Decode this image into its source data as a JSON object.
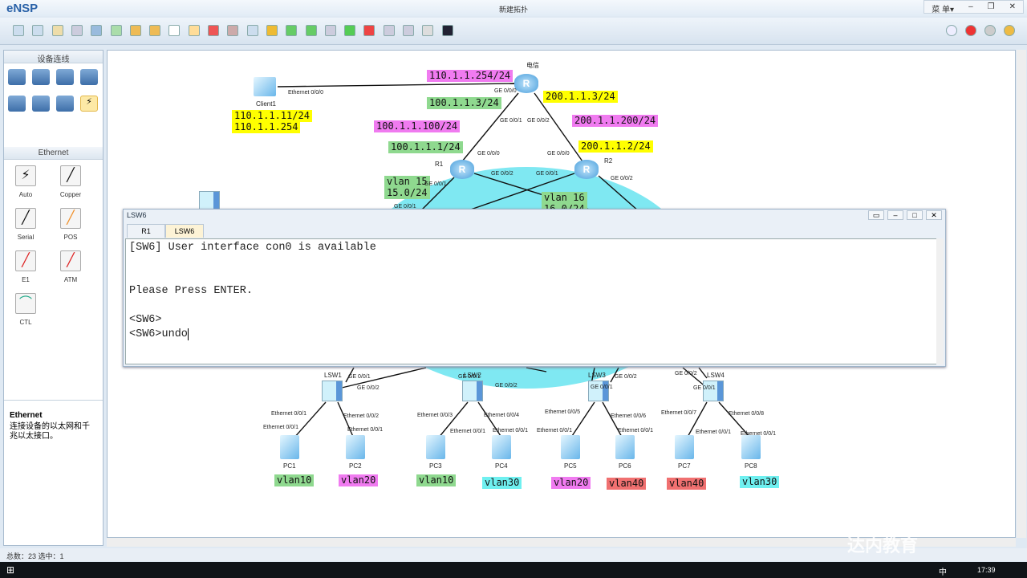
{
  "app": {
    "name": "eNSP",
    "title": "新建拓扑",
    "menu": "菜 单▾",
    "minimize": "–",
    "restore": "❐",
    "close": "✕"
  },
  "toolbar": {
    "icons": [
      "new-topo",
      "new-example",
      "open",
      "save",
      "save-as",
      "print",
      "undo",
      "redo",
      "select",
      "pan",
      "delete",
      "delete-link",
      "text",
      "palette",
      "zoom-in",
      "zoom-out",
      "fit",
      "start",
      "stop",
      "collect",
      "topology",
      "grid",
      "cli"
    ],
    "right_icons": [
      "feedback",
      "huawei",
      "settings",
      "help"
    ]
  },
  "left_panel": {
    "devices_header": "设备连线",
    "devices": [
      "router",
      "switch",
      "wlan",
      "firewall",
      "pc",
      "cloud",
      "other",
      "connection"
    ],
    "cables_header": "Ethernet",
    "cables": [
      {
        "label": "Auto",
        "glyph": "⚡"
      },
      {
        "label": "Copper",
        "glyph": "╱"
      },
      {
        "label": "Serial",
        "glyph": "╱"
      },
      {
        "label": "POS",
        "glyph": "╱"
      },
      {
        "label": "E1",
        "glyph": "╱"
      },
      {
        "label": "ATM",
        "glyph": "╱"
      },
      {
        "label": "CTL",
        "glyph": "⌒"
      }
    ],
    "desc_title": "Ethernet",
    "desc_text": "连接设备的以太网和千兆以太接口。"
  },
  "topology": {
    "nodes": [
      "电信",
      "R1",
      "R2",
      "Client1",
      "LSW1",
      "LSW2",
      "LSW3",
      "LSW4",
      "PC1",
      "PC2",
      "PC3",
      "PC4",
      "PC5",
      "PC6",
      "PC7",
      "PC8"
    ],
    "ip_labels": [
      "110.1.1.254/24",
      "100.1.1.3/24",
      "200.1.1.3/24",
      "200.1.1.200/24",
      "100.1.1.100/24",
      "100.1.1.1/24",
      "200.1.1.2/24",
      "vlan 15",
      "15.0/24",
      "vlan 16",
      "16.0/24",
      "110.1.1.11/24",
      "110.1.1.254"
    ],
    "vlan_labels": [
      "vlan10",
      "vlan20",
      "vlan10",
      "vlan30",
      "vlan20",
      "vlan40",
      "vlan40",
      "vlan30"
    ],
    "ports": [
      "Ethernet 0/0/0",
      "GE 0/0/0",
      "GE 0/0/1",
      "GE 0/0/2",
      "GE 0/0/0",
      "GE 0/0/0",
      "GE 0/0/2",
      "GE 0/0/1",
      "GE 0/0/2",
      "GE 0/0/1",
      "GE 0/0/1",
      "GE 0/0/1",
      "GE 0/0/2",
      "GE 0/0/1",
      "GE 0/0/2",
      "GE 0/0/1",
      "GE 0/0/2",
      "GE 0/0/2",
      "GE 0/0/1",
      "Ethernet 0/0/1",
      "Ethernet 0/0/1",
      "Ethernet 0/0/2",
      "Ethernet 0/0/1",
      "Ethernet 0/0/3",
      "Ethernet 0/0/1",
      "Ethernet 0/0/4",
      "Ethernet 0/0/1",
      "Ethernet 0/0/5",
      "Ethernet 0/0/1",
      "Ethernet 0/0/6",
      "Ethernet 0/0/1",
      "Ethernet 0/0/7",
      "Ethernet 0/0/1",
      "Ethernet 0/0/8",
      "Ethernet 0/0/1"
    ]
  },
  "console": {
    "title": "LSW6",
    "tabs": [
      "R1",
      "LSW6"
    ],
    "active_tab": "LSW6",
    "lines": [
      "[SW6] User interface con0 is available",
      "",
      "",
      "Please Press ENTER.",
      "",
      "<SW6>",
      "<SW6>undo"
    ]
  },
  "status": {
    "text": "总数：23 选中：1"
  },
  "watermark": "达内教育",
  "taskbar": {
    "time": "17:39",
    "ime": "中"
  }
}
